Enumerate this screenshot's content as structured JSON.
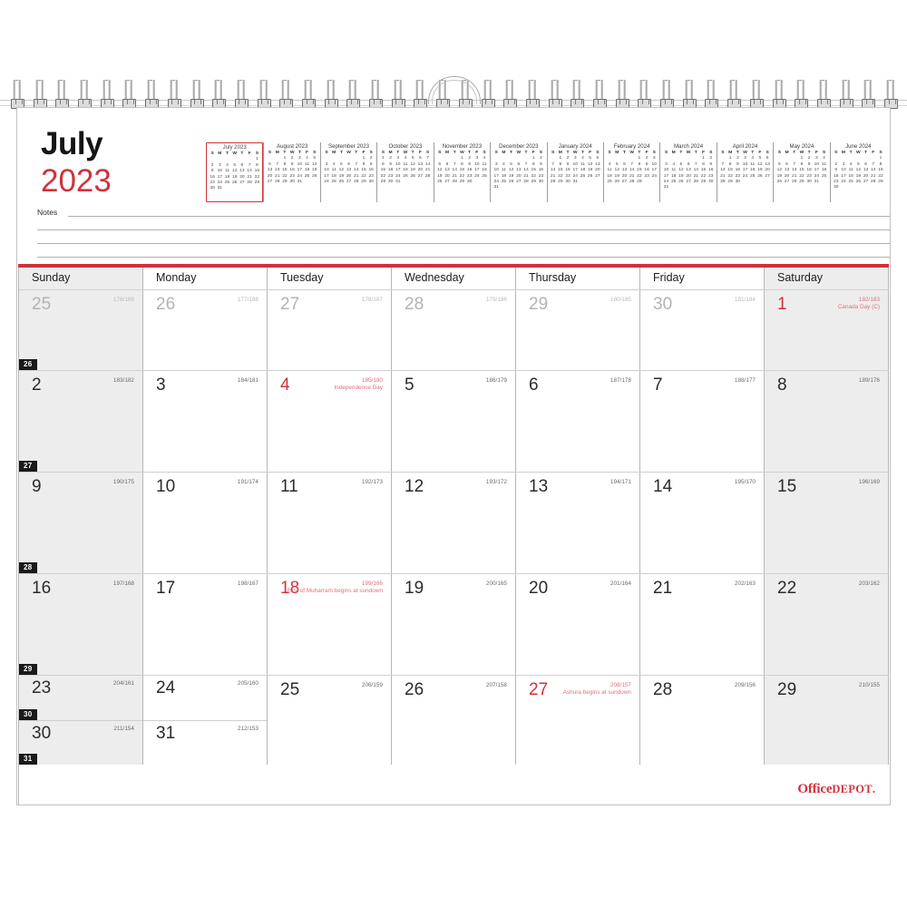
{
  "product": {
    "brand_primary": "Office",
    "brand_secondary": "DEPOT",
    "brand_dot": ".",
    "accent_color": "#d0313c"
  },
  "header": {
    "month": "July",
    "year": "2023",
    "notes_label": "Notes"
  },
  "mini_calendars": [
    {
      "title": "July 2023",
      "current": true,
      "dow": [
        "S",
        "M",
        "T",
        "W",
        "T",
        "F",
        "S"
      ],
      "cells": [
        "",
        "",
        "",
        "",
        "",
        "",
        "1",
        "2",
        "3",
        "4",
        "5",
        "6",
        "7",
        "8",
        "9",
        "10",
        "11",
        "12",
        "13",
        "14",
        "15",
        "16",
        "17",
        "18",
        "19",
        "20",
        "21",
        "22",
        "23",
        "24",
        "25",
        "26",
        "27",
        "28",
        "29",
        "30",
        "31"
      ]
    },
    {
      "title": "August 2023",
      "current": false,
      "dow": [
        "S",
        "M",
        "T",
        "W",
        "T",
        "F",
        "S"
      ],
      "cells": [
        "",
        "",
        "1",
        "2",
        "3",
        "4",
        "5",
        "6",
        "7",
        "8",
        "9",
        "10",
        "11",
        "12",
        "13",
        "14",
        "15",
        "16",
        "17",
        "18",
        "19",
        "20",
        "21",
        "22",
        "23",
        "24",
        "25",
        "26",
        "27",
        "28",
        "29",
        "30",
        "31"
      ]
    },
    {
      "title": "September 2023",
      "current": false,
      "dow": [
        "S",
        "M",
        "T",
        "W",
        "T",
        "F",
        "S"
      ],
      "cells": [
        "",
        "",
        "",
        "",
        "",
        "1",
        "2",
        "3",
        "4",
        "5",
        "6",
        "7",
        "8",
        "9",
        "10",
        "11",
        "12",
        "13",
        "14",
        "15",
        "16",
        "17",
        "18",
        "19",
        "20",
        "21",
        "22",
        "23",
        "24",
        "25",
        "26",
        "27",
        "28",
        "29",
        "30"
      ]
    },
    {
      "title": "October 2023",
      "current": false,
      "dow": [
        "S",
        "M",
        "T",
        "W",
        "T",
        "F",
        "S"
      ],
      "cells": [
        "1",
        "2",
        "3",
        "4",
        "5",
        "6",
        "7",
        "8",
        "9",
        "10",
        "11",
        "12",
        "13",
        "14",
        "15",
        "16",
        "17",
        "18",
        "19",
        "20",
        "21",
        "22",
        "23",
        "24",
        "25",
        "26",
        "27",
        "28",
        "29",
        "30",
        "31"
      ]
    },
    {
      "title": "November 2023",
      "current": false,
      "dow": [
        "S",
        "M",
        "T",
        "W",
        "T",
        "F",
        "S"
      ],
      "cells": [
        "",
        "",
        "",
        "1",
        "2",
        "3",
        "4",
        "5",
        "6",
        "7",
        "8",
        "9",
        "10",
        "11",
        "12",
        "13",
        "14",
        "15",
        "16",
        "17",
        "18",
        "19",
        "20",
        "21",
        "22",
        "23",
        "24",
        "25",
        "26",
        "27",
        "28",
        "29",
        "30"
      ]
    },
    {
      "title": "December 2023",
      "current": false,
      "dow": [
        "S",
        "M",
        "T",
        "W",
        "T",
        "F",
        "S"
      ],
      "cells": [
        "",
        "",
        "",
        "",
        "",
        "1",
        "2",
        "3",
        "4",
        "5",
        "6",
        "7",
        "8",
        "9",
        "10",
        "11",
        "12",
        "13",
        "14",
        "15",
        "16",
        "17",
        "18",
        "19",
        "20",
        "21",
        "22",
        "23",
        "24",
        "25",
        "26",
        "27",
        "28",
        "29",
        "30",
        "31"
      ]
    },
    {
      "title": "January 2024",
      "current": false,
      "dow": [
        "S",
        "M",
        "T",
        "W",
        "T",
        "F",
        "S"
      ],
      "cells": [
        "",
        "1",
        "2",
        "3",
        "4",
        "5",
        "6",
        "7",
        "8",
        "9",
        "10",
        "11",
        "12",
        "13",
        "14",
        "15",
        "16",
        "17",
        "18",
        "19",
        "20",
        "21",
        "22",
        "23",
        "24",
        "25",
        "26",
        "27",
        "28",
        "29",
        "30",
        "31"
      ]
    },
    {
      "title": "February 2024",
      "current": false,
      "dow": [
        "S",
        "M",
        "T",
        "W",
        "T",
        "F",
        "S"
      ],
      "cells": [
        "",
        "",
        "",
        "",
        "1",
        "2",
        "3",
        "4",
        "5",
        "6",
        "7",
        "8",
        "9",
        "10",
        "11",
        "12",
        "13",
        "14",
        "15",
        "16",
        "17",
        "18",
        "19",
        "20",
        "21",
        "22",
        "23",
        "24",
        "25",
        "26",
        "27",
        "28",
        "29"
      ]
    },
    {
      "title": "March 2024",
      "current": false,
      "dow": [
        "S",
        "M",
        "T",
        "W",
        "T",
        "F",
        "S"
      ],
      "cells": [
        "",
        "",
        "",
        "",
        "",
        "1",
        "2",
        "3",
        "4",
        "5",
        "6",
        "7",
        "8",
        "9",
        "10",
        "11",
        "12",
        "13",
        "14",
        "15",
        "16",
        "17",
        "18",
        "19",
        "20",
        "21",
        "22",
        "23",
        "24",
        "25",
        "26",
        "27",
        "28",
        "29",
        "30",
        "31"
      ]
    },
    {
      "title": "April 2024",
      "current": false,
      "dow": [
        "S",
        "M",
        "T",
        "W",
        "T",
        "F",
        "S"
      ],
      "cells": [
        "",
        "1",
        "2",
        "3",
        "4",
        "5",
        "6",
        "7",
        "8",
        "9",
        "10",
        "11",
        "12",
        "13",
        "14",
        "15",
        "16",
        "17",
        "18",
        "19",
        "20",
        "21",
        "22",
        "23",
        "24",
        "25",
        "26",
        "27",
        "28",
        "29",
        "30"
      ]
    },
    {
      "title": "May 2024",
      "current": false,
      "dow": [
        "S",
        "M",
        "T",
        "W",
        "T",
        "F",
        "S"
      ],
      "cells": [
        "",
        "",
        "",
        "1",
        "2",
        "3",
        "4",
        "5",
        "6",
        "7",
        "8",
        "9",
        "10",
        "11",
        "12",
        "13",
        "14",
        "15",
        "16",
        "17",
        "18",
        "19",
        "20",
        "21",
        "22",
        "23",
        "24",
        "25",
        "26",
        "27",
        "28",
        "29",
        "30",
        "31"
      ]
    },
    {
      "title": "June 2024",
      "current": false,
      "dow": [
        "S",
        "M",
        "T",
        "W",
        "T",
        "F",
        "S"
      ],
      "cells": [
        "",
        "",
        "",
        "",
        "",
        "",
        "1",
        "2",
        "3",
        "4",
        "5",
        "6",
        "7",
        "8",
        "9",
        "10",
        "11",
        "12",
        "13",
        "14",
        "15",
        "16",
        "17",
        "18",
        "19",
        "20",
        "21",
        "22",
        "23",
        "24",
        "25",
        "26",
        "27",
        "28",
        "29",
        "30"
      ]
    }
  ],
  "weekday_headers": [
    "Sunday",
    "Monday",
    "Tuesday",
    "Wednesday",
    "Thursday",
    "Friday",
    "Saturday"
  ],
  "weeks": [
    {
      "number": "26",
      "days": [
        {
          "day": "25",
          "doy": "176/189",
          "event": "",
          "out": true,
          "holiday": false
        },
        {
          "day": "26",
          "doy": "177/188",
          "event": "",
          "out": true,
          "holiday": false
        },
        {
          "day": "27",
          "doy": "178/187",
          "event": "",
          "out": true,
          "holiday": false
        },
        {
          "day": "28",
          "doy": "179/186",
          "event": "",
          "out": true,
          "holiday": false
        },
        {
          "day": "29",
          "doy": "180/185",
          "event": "",
          "out": true,
          "holiday": false
        },
        {
          "day": "30",
          "doy": "181/184",
          "event": "",
          "out": true,
          "holiday": false
        },
        {
          "day": "1",
          "doy": "182/183",
          "event": "Canada Day (C)",
          "out": false,
          "holiday": true
        }
      ]
    },
    {
      "number": "27",
      "days": [
        {
          "day": "2",
          "doy": "183/182",
          "event": "",
          "out": false,
          "holiday": false
        },
        {
          "day": "3",
          "doy": "184/181",
          "event": "",
          "out": false,
          "holiday": false
        },
        {
          "day": "4",
          "doy": "185/180",
          "event": "Independence Day",
          "out": false,
          "holiday": true
        },
        {
          "day": "5",
          "doy": "186/179",
          "event": "",
          "out": false,
          "holiday": false
        },
        {
          "day": "6",
          "doy": "187/178",
          "event": "",
          "out": false,
          "holiday": false
        },
        {
          "day": "7",
          "doy": "188/177",
          "event": "",
          "out": false,
          "holiday": false
        },
        {
          "day": "8",
          "doy": "189/176",
          "event": "",
          "out": false,
          "holiday": false
        }
      ]
    },
    {
      "number": "28",
      "days": [
        {
          "day": "9",
          "doy": "190/175",
          "event": "",
          "out": false,
          "holiday": false
        },
        {
          "day": "10",
          "doy": "191/174",
          "event": "",
          "out": false,
          "holiday": false
        },
        {
          "day": "11",
          "doy": "192/173",
          "event": "",
          "out": false,
          "holiday": false
        },
        {
          "day": "12",
          "doy": "193/172",
          "event": "",
          "out": false,
          "holiday": false
        },
        {
          "day": "13",
          "doy": "194/171",
          "event": "",
          "out": false,
          "holiday": false
        },
        {
          "day": "14",
          "doy": "195/170",
          "event": "",
          "out": false,
          "holiday": false
        },
        {
          "day": "15",
          "doy": "196/169",
          "event": "",
          "out": false,
          "holiday": false
        }
      ]
    },
    {
      "number": "29",
      "days": [
        {
          "day": "16",
          "doy": "197/168",
          "event": "",
          "out": false,
          "holiday": false
        },
        {
          "day": "17",
          "doy": "198/167",
          "event": "",
          "out": false,
          "holiday": false
        },
        {
          "day": "18",
          "doy": "199/166",
          "event": "First of Muharram begins at sundown",
          "out": false,
          "holiday": true
        },
        {
          "day": "19",
          "doy": "200/165",
          "event": "",
          "out": false,
          "holiday": false
        },
        {
          "day": "20",
          "doy": "201/164",
          "event": "",
          "out": false,
          "holiday": false
        },
        {
          "day": "21",
          "doy": "202/163",
          "event": "",
          "out": false,
          "holiday": false
        },
        {
          "day": "22",
          "doy": "203/162",
          "event": "",
          "out": false,
          "holiday": false
        }
      ]
    },
    {
      "number": "30",
      "days": [
        {
          "day": "23",
          "doy": "204/161",
          "event": "",
          "out": false,
          "holiday": false
        },
        {
          "day": "24",
          "doy": "205/160",
          "event": "",
          "out": false,
          "holiday": false
        },
        {
          "day": "25",
          "doy": "206/159",
          "event": "",
          "out": false,
          "holiday": false
        },
        {
          "day": "26",
          "doy": "207/158",
          "event": "",
          "out": false,
          "holiday": false
        },
        {
          "day": "27",
          "doy": "208/157",
          "event": "Ashura begins at sundown",
          "out": false,
          "holiday": true
        },
        {
          "day": "28",
          "doy": "209/156",
          "event": "",
          "out": false,
          "holiday": false
        },
        {
          "day": "29",
          "doy": "210/155",
          "event": "",
          "out": false,
          "holiday": false
        }
      ]
    },
    {
      "number": "31",
      "days": [
        {
          "day": "30",
          "doy": "211/154",
          "event": "",
          "out": false,
          "holiday": false
        },
        {
          "day": "31",
          "doy": "212/153",
          "event": "",
          "out": false,
          "holiday": false
        },
        {
          "day": "",
          "doy": "",
          "event": "",
          "out": false,
          "holiday": false
        },
        {
          "day": "",
          "doy": "",
          "event": "",
          "out": false,
          "holiday": false
        },
        {
          "day": "",
          "doy": "",
          "event": "",
          "out": false,
          "holiday": false
        },
        {
          "day": "",
          "doy": "",
          "event": "",
          "out": false,
          "holiday": false
        },
        {
          "day": "",
          "doy": "",
          "event": "",
          "out": false,
          "holiday": false
        }
      ]
    }
  ]
}
